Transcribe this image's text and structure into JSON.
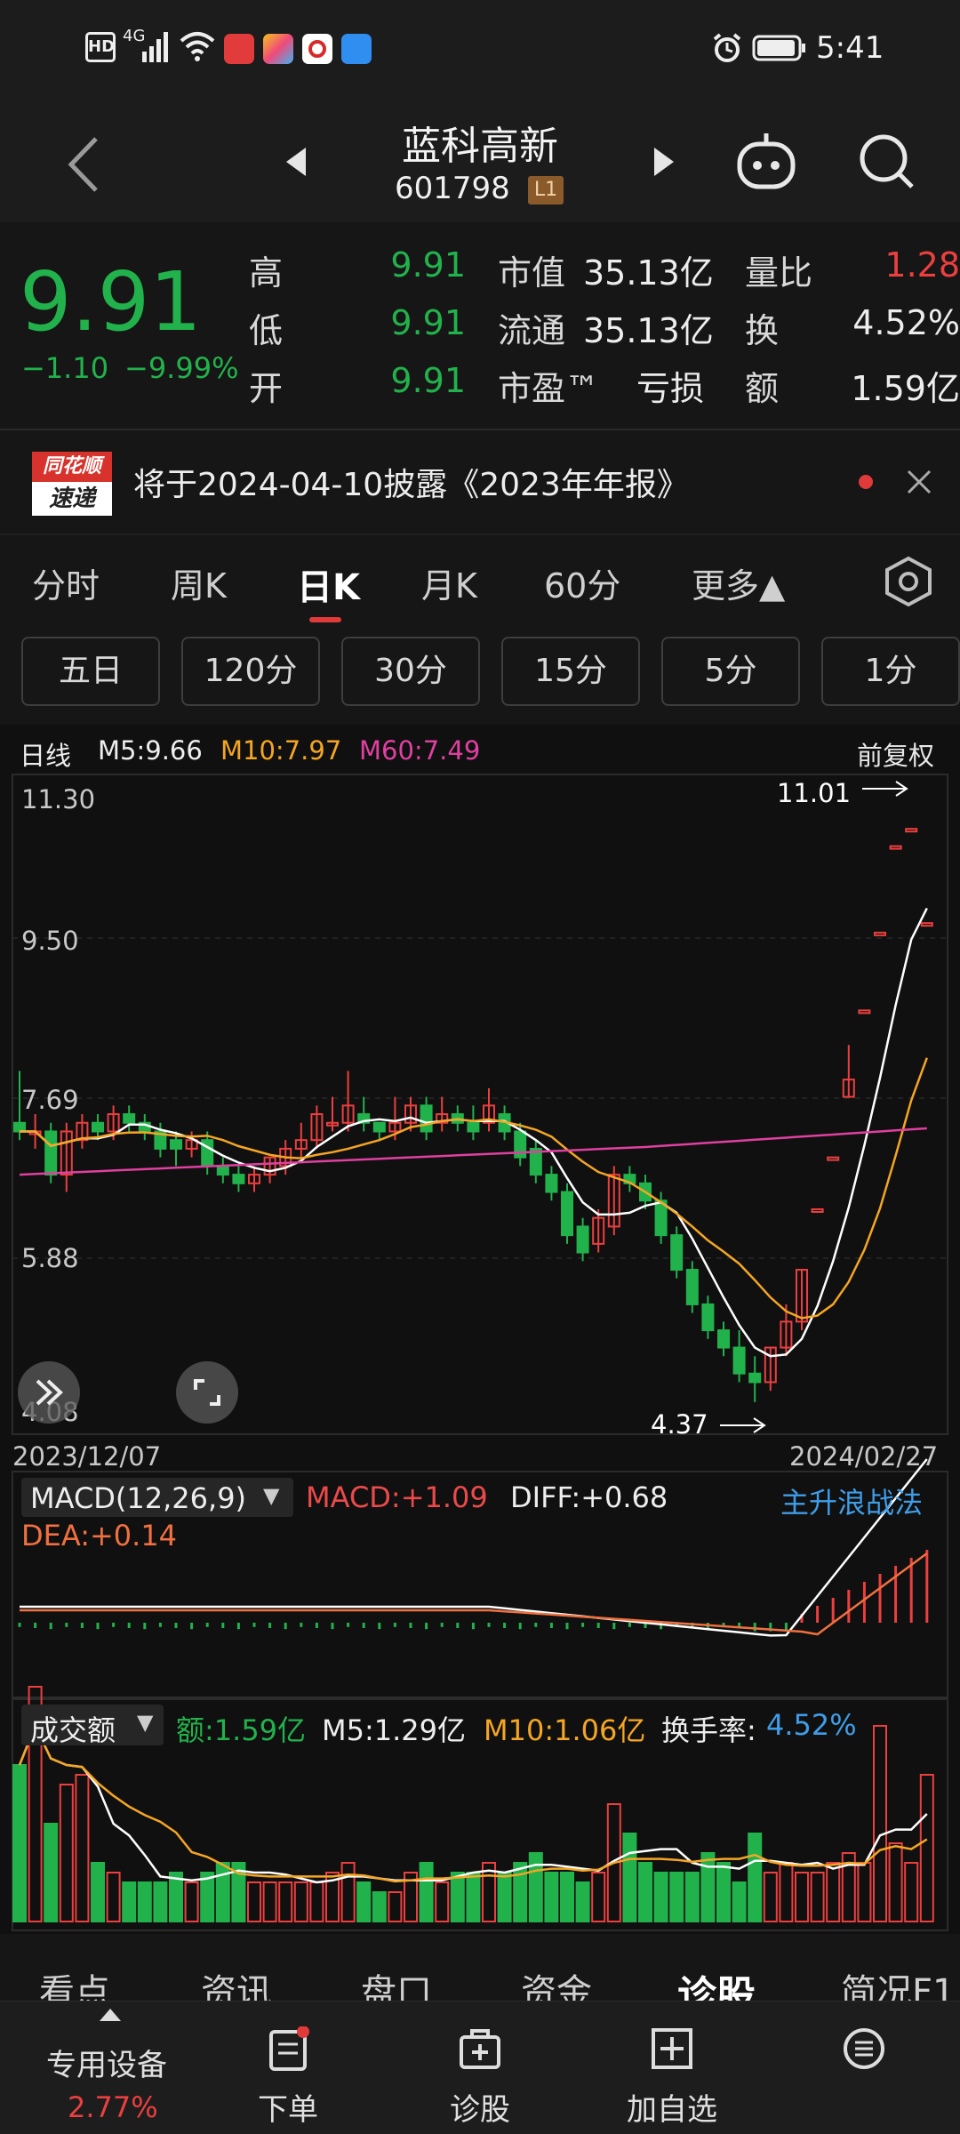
{
  "status_bar": {
    "left_badges": [
      "HD",
      "4G"
    ],
    "time": "5:41",
    "icons": [
      "signal-icon",
      "wifi-icon",
      "app-icon-red",
      "app-icon-multicolor",
      "app-icon-bank",
      "cloud-icon",
      "alarm-icon",
      "battery-icon"
    ]
  },
  "header": {
    "title": "蓝科高新",
    "code": "601798",
    "badge": "L1",
    "icons": [
      "back-icon",
      "prev-stock-icon",
      "next-stock-icon",
      "robot-icon",
      "search-icon"
    ]
  },
  "quote": {
    "price": "9.91",
    "change": "−1.10",
    "change_pct": "−9.99%",
    "rows": [
      {
        "l1": "高",
        "v1": "9.91",
        "l2": "市值",
        "v2": "35.13亿",
        "l3": "量比",
        "v3": "1.28"
      },
      {
        "l1": "低",
        "v1": "9.91",
        "l2": "流通",
        "v2": "35.13亿",
        "l3": "换",
        "v3": "4.52%"
      },
      {
        "l1": "开",
        "v1": "9.91",
        "l2": "市盈™",
        "v2": "亏损",
        "l3": "额",
        "v3": "1.59亿"
      }
    ],
    "colors": {
      "down": "#22b24c",
      "up": "#ec3f3f"
    }
  },
  "news": {
    "logo_top": "同花顺",
    "logo_bottom": "速递",
    "text": "将于2024-04-10披露《2023年年报》"
  },
  "period_tabs": [
    "分时",
    "周K",
    "日K",
    "月K",
    "60分",
    "更多▲"
  ],
  "active_tab": "日K",
  "minute_buttons": [
    "五日",
    "120分",
    "30分",
    "15分",
    "5分",
    "1分"
  ],
  "kline": {
    "label": "日线",
    "m5": "M5:9.66",
    "m10": "M10:7.97",
    "m60": "M60:7.49",
    "adjust": "前复权",
    "axis": [
      "11.30",
      "9.50",
      "7.69",
      "5.88",
      "4.08"
    ],
    "date_start": "2023/12/07",
    "date_end": "2024/02/27",
    "high_mark": "11.01",
    "low_mark": "4.37",
    "colors": {
      "up": "#ec3f3f",
      "down": "#22b24c",
      "m5": "#ffffff",
      "m10": "#f5a623",
      "m60": "#e040a0"
    }
  },
  "macd": {
    "name": "MACD(12,26,9)",
    "macd": "MACD:+1.09",
    "diff": "DIFF:+0.68",
    "dea": "DEA:+0.14",
    "strategy": "主升浪战法"
  },
  "volume": {
    "name": "成交额",
    "amount": "额:1.59亿",
    "m5": "M5:1.29亿",
    "m10": "M10:1.06亿",
    "turnover_label": "换手率:",
    "turnover": "4.52%"
  },
  "chart_data": {
    "type": "candlestick",
    "ylim": [
      4.08,
      11.3
    ],
    "candles": [
      [
        7.6,
        7.5,
        8.2,
        7.4
      ],
      [
        7.5,
        7.5,
        7.7,
        7.3
      ],
      [
        7.5,
        7.0,
        7.6,
        6.9
      ],
      [
        7.0,
        7.5,
        7.6,
        6.8
      ],
      [
        7.4,
        7.6,
        7.7,
        7.3
      ],
      [
        7.6,
        7.5,
        7.7,
        7.4
      ],
      [
        7.5,
        7.7,
        7.8,
        7.4
      ],
      [
        7.7,
        7.6,
        7.8,
        7.5
      ],
      [
        7.6,
        7.5,
        7.7,
        7.4
      ],
      [
        7.5,
        7.3,
        7.6,
        7.2
      ],
      [
        7.4,
        7.3,
        7.5,
        7.1
      ],
      [
        7.3,
        7.4,
        7.5,
        7.2
      ],
      [
        7.4,
        7.1,
        7.5,
        7.0
      ],
      [
        7.1,
        7.0,
        7.2,
        6.9
      ],
      [
        7.0,
        6.9,
        7.1,
        6.8
      ],
      [
        6.9,
        7.0,
        7.1,
        6.8
      ],
      [
        7.0,
        7.2,
        7.2,
        6.9
      ],
      [
        7.1,
        7.3,
        7.4,
        7.0
      ],
      [
        7.3,
        7.4,
        7.6,
        7.2
      ],
      [
        7.4,
        7.7,
        7.8,
        7.3
      ],
      [
        7.6,
        7.6,
        7.9,
        7.5
      ],
      [
        7.6,
        7.8,
        8.2,
        7.5
      ],
      [
        7.7,
        7.6,
        7.9,
        7.5
      ],
      [
        7.6,
        7.5,
        7.6,
        7.4
      ],
      [
        7.5,
        7.6,
        7.9,
        7.4
      ],
      [
        7.6,
        7.8,
        7.9,
        7.5
      ],
      [
        7.8,
        7.5,
        7.9,
        7.4
      ],
      [
        7.6,
        7.7,
        7.9,
        7.5
      ],
      [
        7.7,
        7.6,
        7.8,
        7.5
      ],
      [
        7.6,
        7.5,
        7.8,
        7.4
      ],
      [
        7.6,
        7.8,
        8.0,
        7.5
      ],
      [
        7.7,
        7.5,
        7.8,
        7.4
      ],
      [
        7.5,
        7.2,
        7.6,
        7.1
      ],
      [
        7.3,
        7.0,
        7.4,
        6.9
      ],
      [
        7.0,
        6.8,
        7.1,
        6.7
      ],
      [
        6.8,
        6.3,
        6.9,
        6.2
      ],
      [
        6.4,
        6.1,
        6.5,
        6.0
      ],
      [
        6.2,
        6.5,
        6.6,
        6.1
      ],
      [
        6.4,
        7.0,
        7.1,
        6.3
      ],
      [
        7.0,
        6.9,
        7.1,
        6.8
      ],
      [
        6.9,
        6.7,
        7.0,
        6.6
      ],
      [
        6.7,
        6.3,
        6.8,
        6.2
      ],
      [
        6.3,
        5.9,
        6.4,
        5.8
      ],
      [
        5.9,
        5.5,
        6.0,
        5.4
      ],
      [
        5.5,
        5.2,
        5.6,
        5.1
      ],
      [
        5.2,
        5.0,
        5.3,
        4.9
      ],
      [
        5.0,
        4.7,
        5.2,
        4.6
      ],
      [
        4.7,
        4.6,
        4.9,
        4.37
      ],
      [
        4.6,
        5.0,
        5.0,
        4.5
      ],
      [
        5.0,
        5.3,
        5.5,
        4.9
      ],
      [
        5.3,
        5.9,
        5.9,
        5.2
      ],
      [
        6.6,
        6.6,
        6.6,
        6.6
      ],
      [
        7.2,
        7.2,
        7.2,
        7.2
      ],
      [
        7.9,
        8.1,
        8.5,
        7.9
      ],
      [
        8.9,
        8.9,
        8.9,
        8.9
      ],
      [
        9.8,
        9.8,
        9.8,
        9.8
      ],
      [
        10.8,
        10.8,
        10.8,
        10.8
      ],
      [
        11.0,
        11.0,
        11.01,
        11.0
      ],
      [
        9.91,
        9.91,
        9.91,
        9.91
      ]
    ],
    "volume": [
      1.6,
      2.4,
      1.0,
      1.4,
      1.5,
      0.6,
      0.5,
      0.4,
      0.4,
      0.4,
      0.5,
      0.4,
      0.5,
      0.6,
      0.6,
      0.4,
      0.4,
      0.4,
      0.4,
      0.4,
      0.5,
      0.6,
      0.4,
      0.3,
      0.3,
      0.5,
      0.6,
      0.4,
      0.5,
      0.5,
      0.6,
      0.5,
      0.6,
      0.7,
      0.5,
      0.5,
      0.4,
      0.5,
      1.2,
      0.9,
      0.6,
      0.5,
      0.5,
      0.5,
      0.7,
      0.6,
      0.4,
      0.9,
      0.5,
      0.6,
      0.5,
      0.5,
      0.6,
      0.7,
      0.6,
      2.0,
      0.8,
      0.6,
      1.5
    ]
  }
}
